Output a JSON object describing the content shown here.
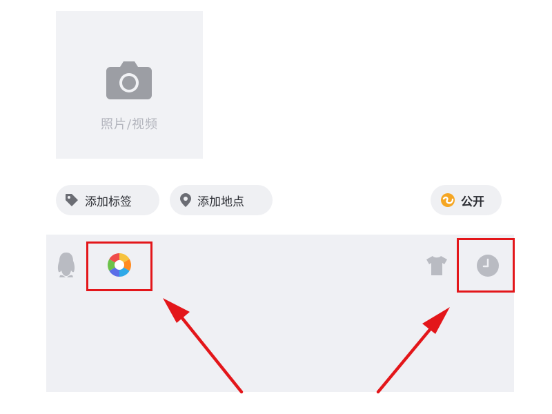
{
  "photo_picker": {
    "label": "照片/视频",
    "icon": "camera-icon"
  },
  "chips": {
    "tag": {
      "label": "添加标签",
      "icon": "tag-icon"
    },
    "location": {
      "label": "添加地点",
      "icon": "location-pin-icon"
    },
    "visibility": {
      "label": "公开",
      "icon": "globe-icon"
    }
  },
  "toolbar": {
    "icons": [
      "qq-penguin-icon",
      "color-wheel-icon",
      "shirt-icon",
      "clock-icon"
    ]
  },
  "colors": {
    "highlight": "#e3161a",
    "icon_gray": "#b9bbc2",
    "surface": "#eff0f4",
    "globe": "#f5a623"
  }
}
